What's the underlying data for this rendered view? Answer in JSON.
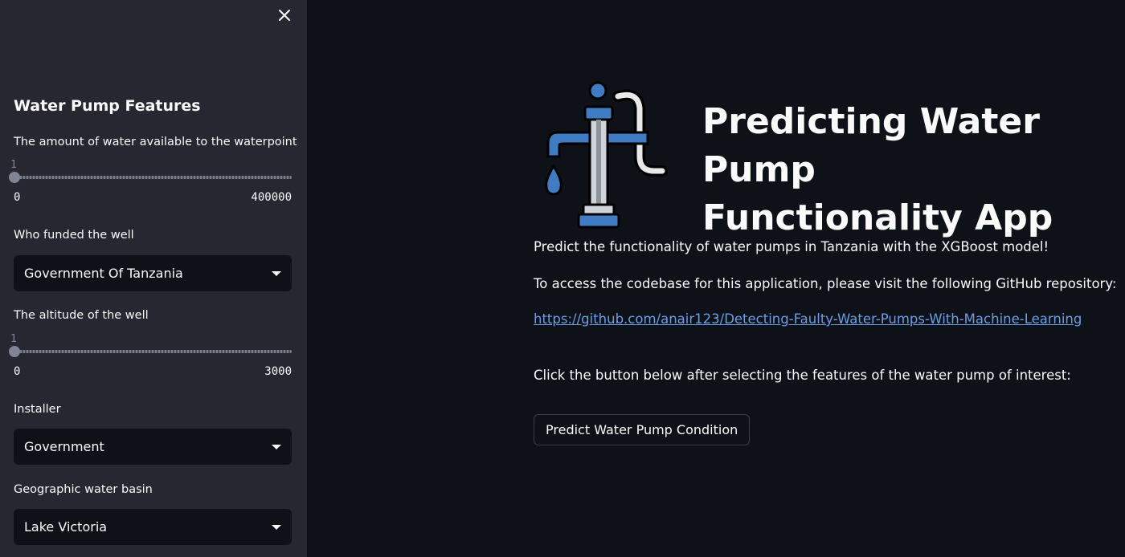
{
  "sidebar": {
    "close_icon": "close-icon",
    "title": "Water Pump Features",
    "water_amount": {
      "label": "The amount of water available to the waterpoint",
      "value": "1",
      "min": "0",
      "max": "400000"
    },
    "funder": {
      "label": "Who funded the well",
      "selected": "Government Of Tanzania"
    },
    "altitude": {
      "label": "The altitude of the well",
      "value": "1",
      "min": "0",
      "max": "3000"
    },
    "installer": {
      "label": "Installer",
      "selected": "Government"
    },
    "basin": {
      "label": "Geographic water basin",
      "selected": "Lake Victoria"
    }
  },
  "main": {
    "logo_icon": "water-pump-icon",
    "title_line1": "Predicting Water Pump",
    "title_line2": "Functionality App",
    "intro": "Predict the functionality of water pumps in Tanzania with the XGBoost model!",
    "codebase_text": "To access the codebase for this application, please visit the following GitHub repository:",
    "repo_link": "https://github.com/anair123/Detecting-Faulty-Water-Pumps-With-Machine-Learning",
    "instruction": "Click the button below after selecting the features of the water pump of interest:",
    "predict_button": "Predict Water Pump Condition"
  },
  "colors": {
    "background": "#0e1117",
    "sidebar": "#262730",
    "link": "#6a9fe8",
    "pump_blue": "#3f7cc4"
  }
}
